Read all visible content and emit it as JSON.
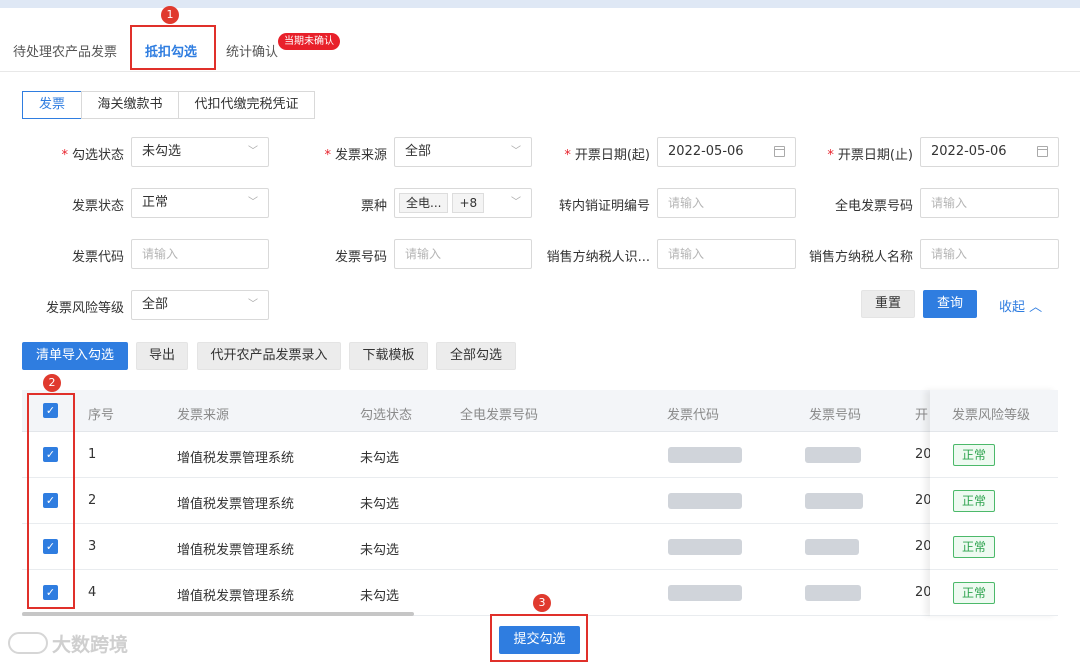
{
  "tabs": [
    {
      "label": "待处理农产品发票",
      "active": false
    },
    {
      "label": "抵扣勾选",
      "active": true
    },
    {
      "label": "统计确认",
      "active": false
    }
  ],
  "tab_badge": "当期未确认",
  "steps": [
    "1",
    "2",
    "3"
  ],
  "segments": [
    {
      "label": "发票",
      "active": true
    },
    {
      "label": "海关缴款书",
      "active": false
    },
    {
      "label": "代扣代缴完税凭证",
      "active": false
    }
  ],
  "form": {
    "select_status": {
      "label": "勾选状态",
      "required": true,
      "value": "未勾选"
    },
    "invoice_source": {
      "label": "发票来源",
      "required": true,
      "value": "全部"
    },
    "issue_date_start": {
      "label": "开票日期(起)",
      "required": true,
      "value": "2022-05-06"
    },
    "issue_date_end": {
      "label": "开票日期(止)",
      "required": true,
      "value": "2022-05-06"
    },
    "invoice_status": {
      "label": "发票状态",
      "value": "正常"
    },
    "invoice_type": {
      "label": "票种",
      "tag": "全电...",
      "more": "+8"
    },
    "transfer_cert_no": {
      "label": "转内销证明编号",
      "placeholder": "请输入"
    },
    "digital_invoice_no": {
      "label": "全电发票号码",
      "placeholder": "请输入"
    },
    "invoice_code": {
      "label": "发票代码",
      "placeholder": "请输入"
    },
    "invoice_number": {
      "label": "发票号码",
      "placeholder": "请输入"
    },
    "seller_tax_id": {
      "label": "销售方纳税人识...",
      "placeholder": "请输入"
    },
    "seller_name": {
      "label": "销售方纳税人名称",
      "placeholder": "请输入"
    },
    "risk_level": {
      "label": "发票风险等级",
      "value": "全部"
    }
  },
  "form_actions": {
    "reset": "重置",
    "query": "查询",
    "collapse": "收起"
  },
  "toolbar": {
    "import_select": "清单导入勾选",
    "export": "导出",
    "agent_entry": "代开农产品发票录入",
    "download_template": "下载模板",
    "select_all": "全部勾选"
  },
  "table": {
    "columns": [
      "序号",
      "发票来源",
      "勾选状态",
      "全电发票号码",
      "发票代码",
      "发票号码",
      "开",
      "发票风险等级"
    ],
    "rows": [
      {
        "index": "1",
        "source": "增值税发票管理系统",
        "status": "未勾选",
        "date_partial": "20",
        "risk": "正常"
      },
      {
        "index": "2",
        "source": "增值税发票管理系统",
        "status": "未勾选",
        "date_partial": "20",
        "risk": "正常"
      },
      {
        "index": "3",
        "source": "增值税发票管理系统",
        "status": "未勾选",
        "date_partial": "20",
        "risk": "正常"
      },
      {
        "index": "4",
        "source": "增值税发票管理系统",
        "status": "未勾选",
        "date_partial": "20",
        "risk": "正常"
      }
    ]
  },
  "submit_label": "提交勾选",
  "watermark": "大数跨境",
  "colors": {
    "primary": "#2f7de0",
    "annotation": "#e0302a",
    "success": "#2ea44f"
  }
}
